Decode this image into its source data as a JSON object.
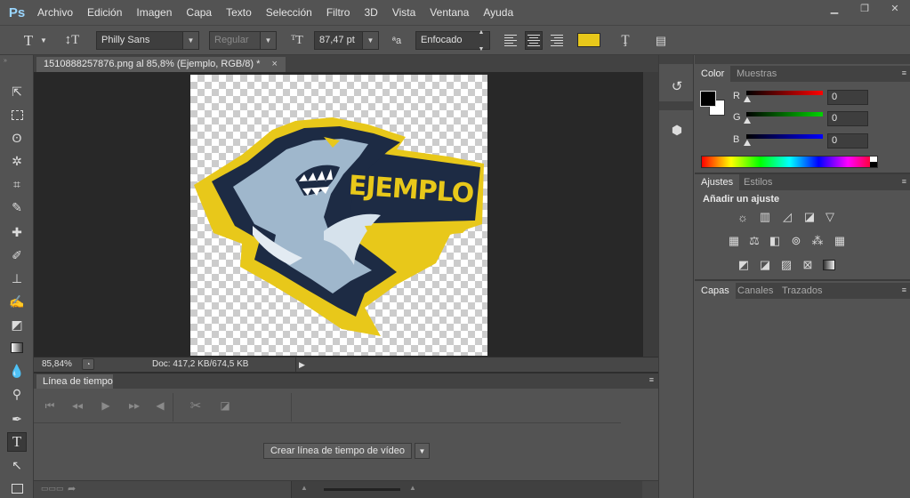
{
  "menubar": {
    "logo": "Ps",
    "items": [
      "Archivo",
      "Edición",
      "Imagen",
      "Capa",
      "Texto",
      "Selección",
      "Filtro",
      "3D",
      "Vista",
      "Ventana",
      "Ayuda"
    ]
  },
  "options": {
    "font_family": "Philly Sans",
    "font_style": "Regular",
    "font_size": "87,47 pt",
    "antialias_symbol": "ªa",
    "antialias": "Enfocado",
    "text_color": "#e8c81a"
  },
  "document": {
    "tab_title": "1510888257876.png al 85,8% (Ejemplo, RGB/8) *",
    "close": "×",
    "logo_text": "EJEMPLO"
  },
  "status": {
    "zoom": "85,84%",
    "doc_info": "Doc: 417,2 KB/674,5 KB"
  },
  "timeline": {
    "tab": "Línea de tiempo",
    "create_button": "Crear línea de tiempo de vídeo"
  },
  "panels": {
    "color": {
      "tabs": [
        "Color",
        "Muestras"
      ],
      "r_label": "R",
      "g_label": "G",
      "b_label": "B",
      "r": "0",
      "g": "0",
      "b": "0"
    },
    "adjustments": {
      "tabs": [
        "Ajustes",
        "Estilos"
      ],
      "heading": "Añadir un ajuste"
    },
    "layers": {
      "tabs": [
        "Capas",
        "Canales",
        "Trazados"
      ]
    }
  }
}
